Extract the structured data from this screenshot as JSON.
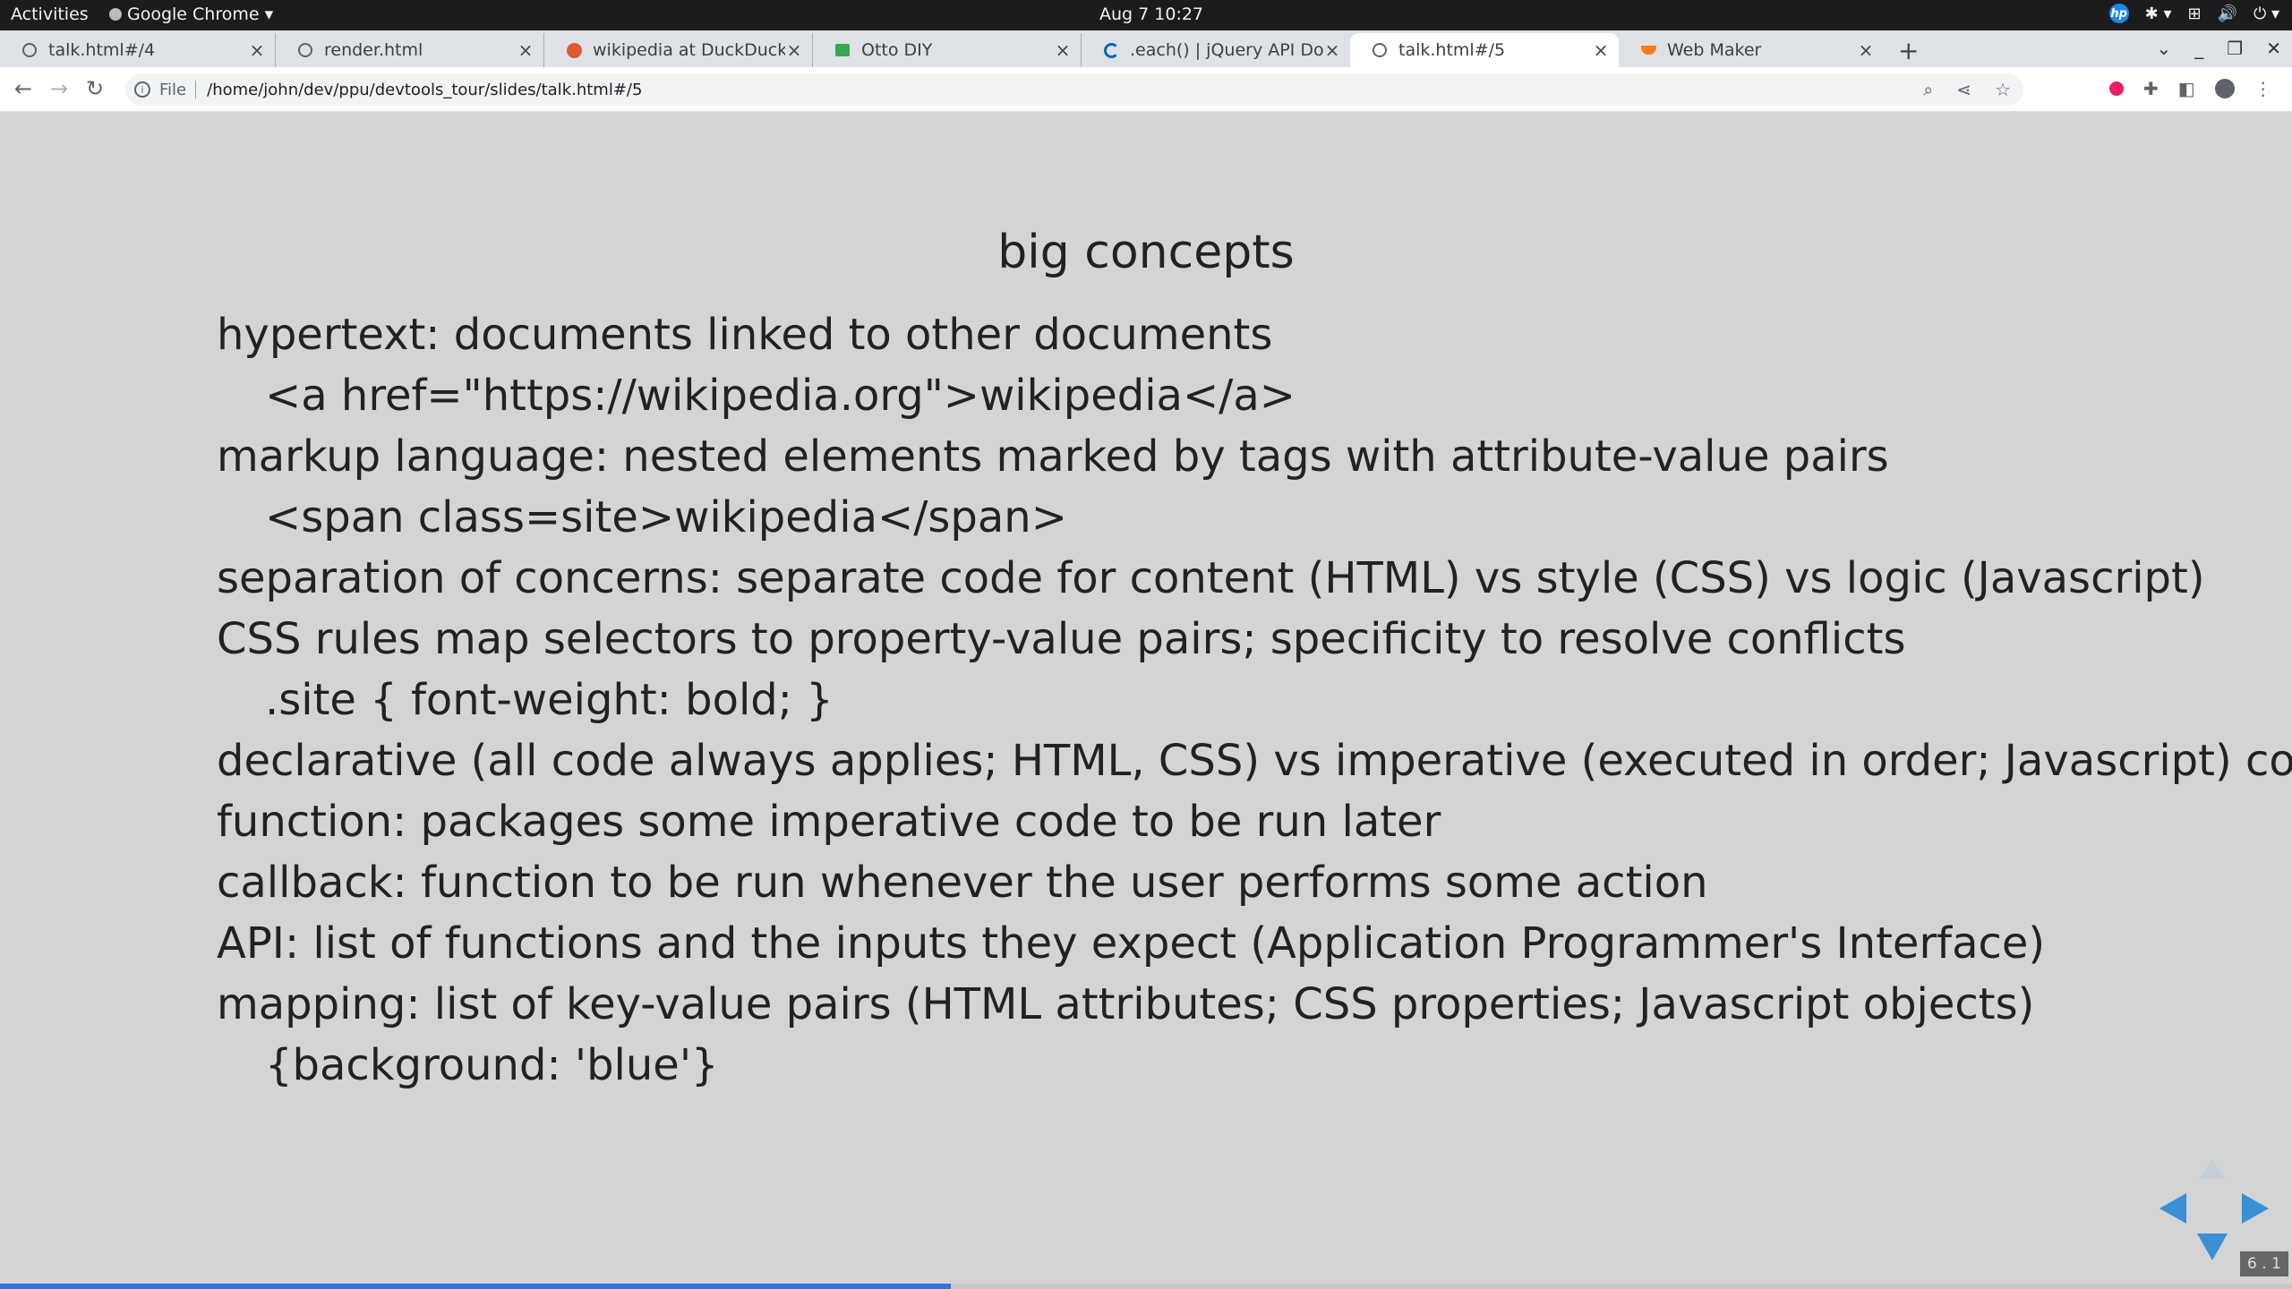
{
  "system_bar": {
    "activities": "Activities",
    "app_name": "Google Chrome",
    "clock": "Aug 7  10:27"
  },
  "tabs": [
    {
      "title": "talk.html#/4",
      "icon": "globe-icon",
      "active": false
    },
    {
      "title": "render.html",
      "icon": "globe-icon",
      "active": false
    },
    {
      "title": "wikipedia at DuckDuckGo",
      "icon": "duckduckgo-icon",
      "active": false
    },
    {
      "title": "Otto DIY",
      "icon": "otto-icon",
      "active": false
    },
    {
      "title": ".each() | jQuery API Docur",
      "icon": "jquery-icon",
      "active": false
    },
    {
      "title": "talk.html#/5",
      "icon": "globe-icon",
      "active": true
    },
    {
      "title": "Web Maker",
      "icon": "webmaker-icon",
      "active": false
    }
  ],
  "address_bar": {
    "scheme": "File",
    "url": "/home/john/dev/ppu/devtools_tour/slides/talk.html#/5"
  },
  "slide": {
    "title": "big concepts",
    "items": [
      {
        "level": 1,
        "text": "hypertext: documents linked to other documents"
      },
      {
        "level": 2,
        "text": "<a href=\"https://wikipedia.org\">wikipedia</a>"
      },
      {
        "level": 1,
        "text": "markup language: nested elements marked by tags with attribute-value pairs"
      },
      {
        "level": 2,
        "text": "<span class=site>wikipedia</span>"
      },
      {
        "level": 1,
        "text": "separation of concerns: separate code for content (HTML) vs style (CSS) vs logic (Javascript)"
      },
      {
        "level": 1,
        "text": "CSS rules map selectors to property-value pairs; specificity to resolve conflicts"
      },
      {
        "level": 2,
        "text": ".site { font-weight: bold; }"
      },
      {
        "level": 1,
        "text": "declarative (all code always applies; HTML, CSS) vs imperative (executed in order; Javascript) code"
      },
      {
        "level": 1,
        "text": "function: packages some imperative code to be run later"
      },
      {
        "level": 1,
        "text": "callback: function to be run whenever the user performs some action"
      },
      {
        "level": 1,
        "text": "API: list of functions and the inputs they expect (Application Programmer's Interface)"
      },
      {
        "level": 1,
        "text": "mapping: list of key-value pairs (HTML attributes; CSS properties; Javascript objects)"
      },
      {
        "level": 2,
        "text": "{background: 'blue'}"
      }
    ],
    "slide_number": "6 . 1",
    "progress_fraction": 0.415
  },
  "colors": {
    "slide_background": "#d4d4d4",
    "control_arrow": "#3b8fd6",
    "progress_bar": "#2a76dd"
  }
}
